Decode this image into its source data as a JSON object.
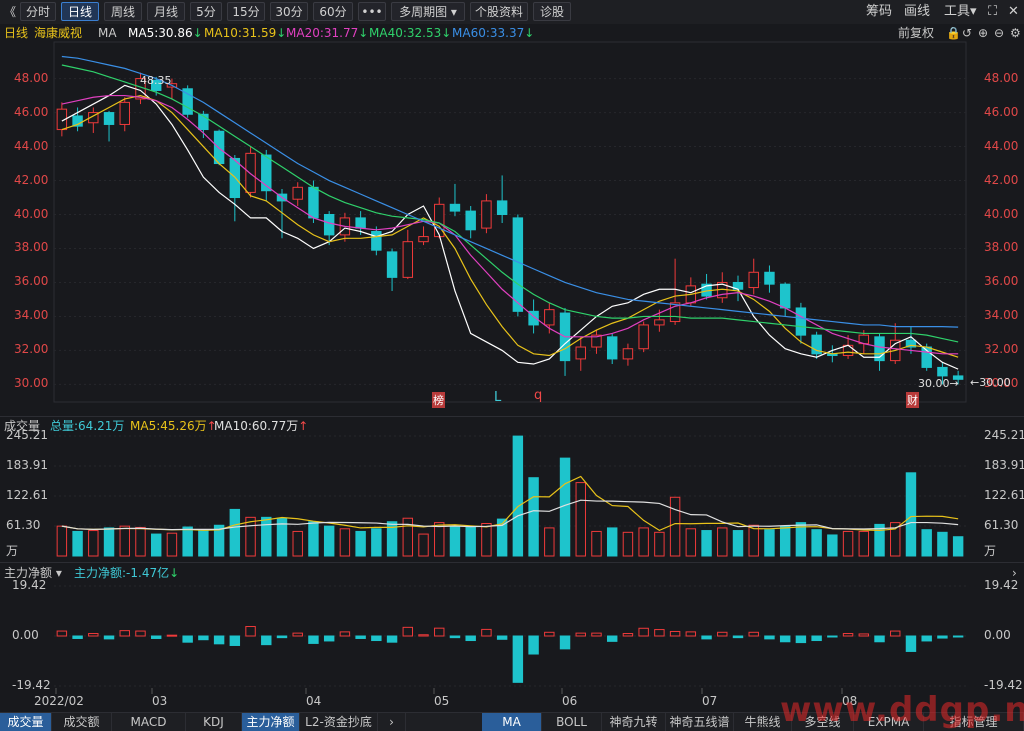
{
  "toolbar": {
    "back": "《",
    "tabs": [
      "分时",
      "日线",
      "周线",
      "月线",
      "5分",
      "15分",
      "30分",
      "60分",
      "•••",
      "多周期图",
      "个股资料",
      "诊股"
    ],
    "dropdown_caret": "▾",
    "right": [
      "筹码",
      "画线",
      "工具"
    ],
    "tools_caret": "▾",
    "expand": "⛶",
    "close": "✕"
  },
  "ma_row": {
    "period": "日线",
    "stock": "海康威视",
    "ma": "MA",
    "ma5": "MA5:30.86",
    "ma10": "MA10:31.59",
    "ma20": "MA20:31.77",
    "ma40": "MA40:32.53",
    "ma60": "MA60:33.37",
    "down_arrow": "↓",
    "adjust": "前复权",
    "colors": {
      "ma5": "#ffffff",
      "ma10": "#e8c21a",
      "ma20": "#e040c0",
      "ma40": "#2fd16b",
      "ma60": "#3a8fe6"
    }
  },
  "price_axis": {
    "ticks": [
      "48.00",
      "46.00",
      "44.00",
      "42.00",
      "40.00",
      "38.00",
      "36.00",
      "34.00",
      "32.00",
      "30.00"
    ]
  },
  "price_annotations": {
    "high": "48.35",
    "low": "30.00→",
    "right_marker": "←30.00",
    "tag1": "榜",
    "tag2": "L",
    "tag3": "q",
    "tag4": "财"
  },
  "volume_panel": {
    "title": "成交量",
    "total": "总量:64.21万",
    "ma5": "MA5:45.26万",
    "ma10": "MA10:60.77万",
    "up_arrow": "↑",
    "ticks": [
      "245.21",
      "183.91",
      "122.61",
      "61.30",
      "万"
    ]
  },
  "fund_panel": {
    "title": "主力净额",
    "caret": "▾",
    "value": "主力净额:-1.47亿",
    "down_arrow": "↓",
    "ticks": [
      "19.42",
      "0.00",
      "-19.42"
    ]
  },
  "date_axis": [
    "2022/02",
    "03",
    "04",
    "05",
    "06",
    "07",
    "08"
  ],
  "bottom_tabs": [
    "成交量",
    "成交额",
    "MACD",
    "KDJ",
    "主力净额",
    "L2-资金抄底",
    "›",
    "MA",
    "BOLL",
    "神奇九转",
    "神奇五线谱",
    "牛熊线",
    "多空线",
    "EXPMA",
    "指标管理"
  ],
  "watermark": "www.ddgp.net",
  "chart_data": {
    "type": "candlestick",
    "title": "海康威视 日线",
    "price_ylim": [
      29.2,
      49.8
    ],
    "volume_ylim": [
      0,
      245.21
    ],
    "fund_ylim": [
      -19.42,
      19.42
    ],
    "x": [
      "2022/02",
      "03",
      "04",
      "05",
      "06",
      "07",
      "08"
    ],
    "series": [
      {
        "name": "MA5",
        "values": [
          45.5,
          46.0,
          46.5,
          47.0,
          47.6,
          47.3,
          46.5,
          45.3,
          43.8,
          42.2,
          41.3,
          40.6,
          39.8,
          39.8,
          39.0,
          38.6,
          38.0,
          38.4,
          39.2,
          39.0,
          38.7,
          39.0,
          40.0,
          40.5,
          38.8,
          35.5,
          33.0,
          32.5,
          32.0,
          31.3,
          31.2,
          31.5,
          32.4,
          33.2,
          34.0,
          34.6,
          34.8,
          35.3,
          35.6,
          35.6,
          35.4,
          35.8,
          35.9,
          35.6,
          34.0,
          32.9,
          32.1,
          31.8,
          31.6,
          32.0,
          32.3,
          31.6,
          31.6,
          32.4,
          32.8,
          32.0,
          31.3,
          30.9
        ]
      },
      {
        "name": "MA10",
        "values": [
          45.0,
          45.3,
          45.8,
          46.3,
          46.8,
          47.0,
          46.7,
          46.0,
          45.0,
          44.0,
          43.0,
          42.2,
          41.1,
          40.8,
          40.1,
          39.4,
          38.8,
          38.4,
          38.6,
          38.6,
          38.7,
          38.8,
          39.3,
          39.8,
          39.3,
          38.0,
          36.2,
          34.7,
          33.4,
          32.3,
          31.8,
          31.7,
          32.1,
          32.7,
          33.2,
          33.6,
          33.9,
          34.4,
          34.9,
          35.2,
          35.3,
          35.5,
          35.6,
          35.5,
          35.0,
          34.3,
          33.3,
          32.5,
          32.0,
          31.8,
          31.9,
          31.8,
          31.8,
          32.0,
          32.3,
          32.2,
          31.9,
          31.6
        ]
      },
      {
        "name": "MA20",
        "values": [
          46.5,
          46.7,
          46.9,
          47.0,
          47.0,
          46.9,
          46.7,
          46.3,
          45.6,
          44.8,
          43.9,
          43.2,
          42.4,
          41.7,
          41.0,
          40.4,
          39.8,
          39.5,
          39.3,
          39.2,
          39.1,
          39.2,
          39.4,
          39.6,
          39.5,
          38.8,
          37.6,
          36.6,
          35.6,
          34.8,
          34.0,
          33.3,
          32.8,
          32.8,
          32.8,
          33.0,
          33.3,
          33.8,
          34.2,
          34.6,
          34.8,
          35.1,
          35.3,
          35.4,
          35.2,
          34.9,
          34.5,
          34.0,
          33.5,
          33.0,
          32.7,
          32.4,
          32.2,
          32.1,
          32.0,
          31.9,
          31.8,
          31.8
        ]
      },
      {
        "name": "MA40",
        "values": [
          48.8,
          48.6,
          48.4,
          48.1,
          47.8,
          47.5,
          47.2,
          46.8,
          46.3,
          45.8,
          45.2,
          44.6,
          44.0,
          43.4,
          42.8,
          42.2,
          41.6,
          41.1,
          40.7,
          40.4,
          40.1,
          39.9,
          39.8,
          39.7,
          39.5,
          39.0,
          38.2,
          37.4,
          36.6,
          35.9,
          35.3,
          34.8,
          34.4,
          34.2,
          34.0,
          33.9,
          33.9,
          34.0,
          34.0,
          34.0,
          33.9,
          33.9,
          33.9,
          33.8,
          33.7,
          33.6,
          33.5,
          33.4,
          33.3,
          33.2,
          33.1,
          33.0,
          33.0,
          33.0,
          33.0,
          32.9,
          32.7,
          32.5
        ]
      },
      {
        "name": "MA60",
        "values": [
          49.3,
          49.2,
          49.0,
          48.8,
          48.6,
          48.3,
          48.0,
          47.6,
          47.1,
          46.6,
          46.0,
          45.4,
          44.8,
          44.2,
          43.6,
          43.0,
          42.5,
          42.0,
          41.6,
          41.2,
          40.8,
          40.4,
          40.0,
          39.6,
          39.2,
          38.8,
          38.4,
          38.0,
          37.6,
          37.2,
          36.8,
          36.4,
          36.0,
          35.7,
          35.4,
          35.2,
          35.0,
          34.9,
          34.8,
          34.7,
          34.6,
          34.5,
          34.4,
          34.3,
          34.2,
          34.1,
          34.0,
          33.9,
          33.8,
          33.7,
          33.6,
          33.5,
          33.5,
          33.4,
          33.4,
          33.4,
          33.4,
          33.37
        ]
      }
    ],
    "candles": [
      [
        45.0,
        46.2,
        46.6,
        44.6
      ],
      [
        45.8,
        45.2,
        46.3,
        44.9
      ],
      [
        45.4,
        46.0,
        46.3,
        44.8
      ],
      [
        46.0,
        45.3,
        46.1,
        44.3
      ],
      [
        45.3,
        46.6,
        46.9,
        44.9
      ],
      [
        46.8,
        48.0,
        48.35,
        46.5
      ],
      [
        47.9,
        47.3,
        48.1,
        47.0
      ],
      [
        47.5,
        47.7,
        48.0,
        46.8
      ],
      [
        47.4,
        45.9,
        47.6,
        45.7
      ],
      [
        45.9,
        45.0,
        46.1,
        44.5
      ],
      [
        44.9,
        43.0,
        45.0,
        42.9
      ],
      [
        43.3,
        41.0,
        43.5,
        39.6
      ],
      [
        41.3,
        43.6,
        44.0,
        41.0
      ],
      [
        43.5,
        41.4,
        43.8,
        40.8
      ],
      [
        41.2,
        40.8,
        41.5,
        38.6
      ],
      [
        40.9,
        41.6,
        41.9,
        40.5
      ],
      [
        41.6,
        39.8,
        42.0,
        39.5
      ],
      [
        40.0,
        38.8,
        40.2,
        38.2
      ],
      [
        38.8,
        39.8,
        40.1,
        38.4
      ],
      [
        39.8,
        39.2,
        40.2,
        38.8
      ],
      [
        39.0,
        37.9,
        39.3,
        37.6
      ],
      [
        37.8,
        36.3,
        38.0,
        35.5
      ],
      [
        36.3,
        38.4,
        39.1,
        36.2
      ],
      [
        38.4,
        38.7,
        39.3,
        38.2
      ],
      [
        38.7,
        40.6,
        41.0,
        38.6
      ],
      [
        40.6,
        40.2,
        41.8,
        39.9
      ],
      [
        40.2,
        39.1,
        40.5,
        38.6
      ],
      [
        39.2,
        40.8,
        41.2,
        38.9
      ],
      [
        40.8,
        40.0,
        42.3,
        39.5
      ],
      [
        39.8,
        34.3,
        40.0,
        34.0
      ],
      [
        34.3,
        33.5,
        35.0,
        33.0
      ],
      [
        33.5,
        34.4,
        34.8,
        33.0
      ],
      [
        34.2,
        31.4,
        34.5,
        30.5
      ],
      [
        31.5,
        32.2,
        32.8,
        30.8
      ],
      [
        32.2,
        32.9,
        33.2,
        31.8
      ],
      [
        32.8,
        31.5,
        33.0,
        31.2
      ],
      [
        31.5,
        32.1,
        32.4,
        31.1
      ],
      [
        32.1,
        33.5,
        33.7,
        31.9
      ],
      [
        33.5,
        33.8,
        34.4,
        33.1
      ],
      [
        33.7,
        34.8,
        37.4,
        33.5
      ],
      [
        34.8,
        35.8,
        36.3,
        34.6
      ],
      [
        35.9,
        35.2,
        36.5,
        35.0
      ],
      [
        35.1,
        36.0,
        36.6,
        34.8
      ],
      [
        36.0,
        35.6,
        36.4,
        34.9
      ],
      [
        35.7,
        36.6,
        37.4,
        35.3
      ],
      [
        36.6,
        35.9,
        37.0,
        35.4
      ],
      [
        35.9,
        34.5,
        36.0,
        34.0
      ],
      [
        34.5,
        32.9,
        34.8,
        32.4
      ],
      [
        32.9,
        31.8,
        33.1,
        31.5
      ],
      [
        31.8,
        31.7,
        32.3,
        31.3
      ],
      [
        31.7,
        32.3,
        32.9,
        31.5
      ],
      [
        32.4,
        32.9,
        33.2,
        31.8
      ],
      [
        32.8,
        31.4,
        33.0,
        30.8
      ],
      [
        31.4,
        32.6,
        33.6,
        31.2
      ],
      [
        32.6,
        32.2,
        33.4,
        31.8
      ],
      [
        32.2,
        31.0,
        32.4,
        30.8
      ],
      [
        31.0,
        30.5,
        31.3,
        30.0
      ],
      [
        30.5,
        30.3,
        30.8,
        30.0
      ]
    ]
  }
}
